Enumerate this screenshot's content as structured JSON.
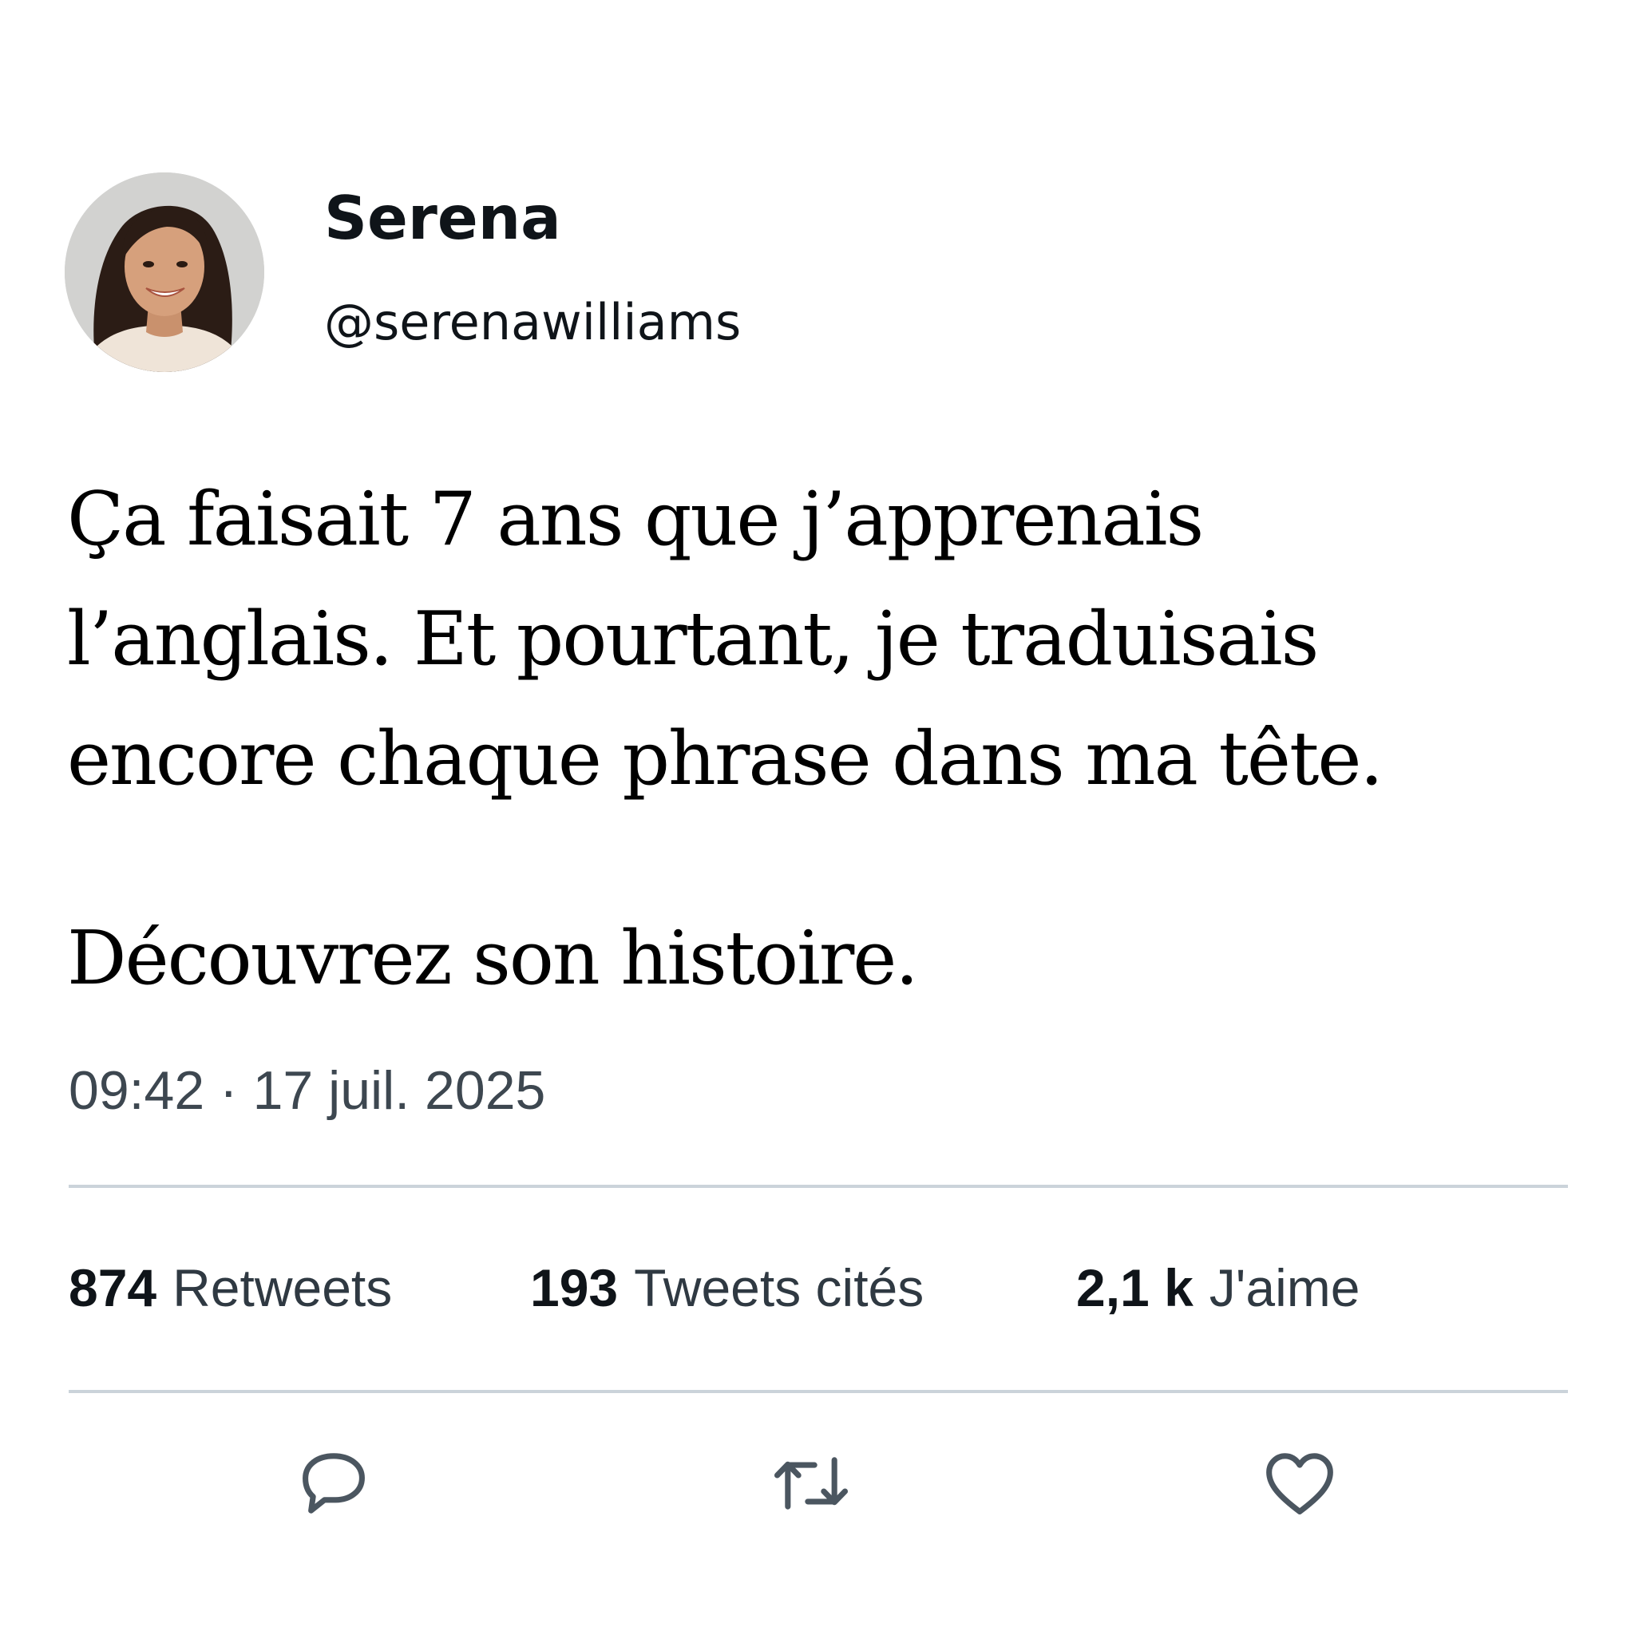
{
  "author": {
    "display_name": "Serena",
    "handle": "@serenawilliams",
    "avatar_icon": "profile-photo"
  },
  "tweet": {
    "lines": [
      "Ça faisait 7 ans que j’apprenais",
      "l’anglais. Et pourtant, je traduisais",
      "encore chaque phrase dans ma tête."
    ],
    "cta": "Découvrez son histoire.",
    "timestamp": "09:42 · 17 juil. 2025"
  },
  "stats": {
    "retweets": {
      "value": "874",
      "label": "Retweets"
    },
    "quotes": {
      "value": "193",
      "label": "Tweets cités"
    },
    "likes": {
      "value": "2,1 k",
      "label": "J'aime"
    }
  },
  "actions": [
    {
      "name": "reply",
      "icon": "reply-icon"
    },
    {
      "name": "retweet",
      "icon": "retweet-icon"
    },
    {
      "name": "like",
      "icon": "heart-icon"
    }
  ],
  "colors": {
    "text": "#0f1419",
    "secondary": "#3d4750",
    "divider": "#cbd3da",
    "icon": "#4b5660"
  }
}
